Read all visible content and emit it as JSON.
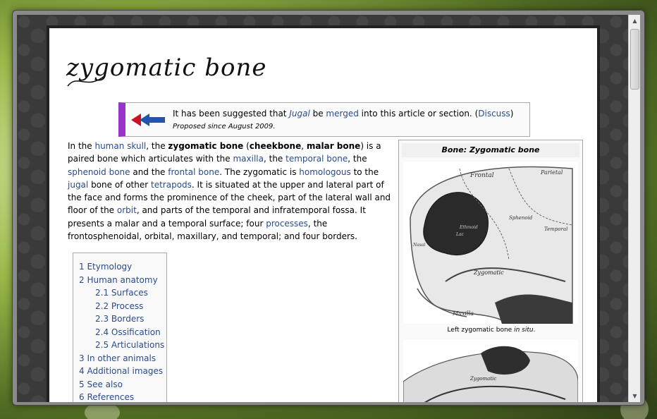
{
  "page": {
    "logo_text": "zygomatic bone"
  },
  "notice": {
    "prefix": "It has been suggested that ",
    "link_jugal": "Jugal",
    "middle1": " be ",
    "link_merged": "merged",
    "middle2": " into this article or section. (",
    "link_discuss": "Discuss",
    "suffix": ")",
    "subtext": "Proposed since August 2009.",
    "accent_color": "#9933cc",
    "icon": "merge-arrows-icon"
  },
  "intro": {
    "t1": "In the ",
    "l_human_skull": "human skull",
    "t2": ", the ",
    "b_zygomatic": "zygomatic bone",
    "t3": " (",
    "b_cheekbone": "cheekbone",
    "t4": ", ",
    "b_malar": "malar bone",
    "t5": ") is a paired bone which articulates with the ",
    "l_maxilla": "maxilla",
    "t6": ", the ",
    "l_temporal": "temporal bone",
    "t7": ", the ",
    "l_sphenoid": "sphenoid bone",
    "t8": " and the ",
    "l_frontal": "frontal bone",
    "t9": ". The zygomatic is ",
    "l_homologous": "homologous",
    "t10": " to the ",
    "l_jugal": "jugal",
    "t11": " bone of other ",
    "l_tetrapods": "tetrapods",
    "t12": ". It is situated at the upper and lateral part of the face and forms the prominence of the cheek, part of the lateral wall and floor of the ",
    "l_orbit": "orbit",
    "t13": ", and parts of the temporal and infratemporal fossa. It presents a malar and a temporal surface; four ",
    "l_processes": "processes",
    "t14": ", the frontosphenoidal, orbital, maxillary, and temporal; and four borders."
  },
  "toc": {
    "items": [
      {
        "label": "1 Etymology",
        "sub": false
      },
      {
        "label": "2 Human anatomy",
        "sub": false
      },
      {
        "label": "2.1 Surfaces",
        "sub": true
      },
      {
        "label": "2.2 Process",
        "sub": true
      },
      {
        "label": "2.3 Borders",
        "sub": true
      },
      {
        "label": "2.4 Ossification",
        "sub": true
      },
      {
        "label": "2.5 Articulations",
        "sub": true
      },
      {
        "label": "3 In other animals",
        "sub": false
      },
      {
        "label": "4 Additional images",
        "sub": false
      },
      {
        "label": "5 See also",
        "sub": false
      },
      {
        "label": "6 References",
        "sub": false
      }
    ]
  },
  "infobox": {
    "title": "Bone: Zygomatic bone",
    "caption_pre": "Left zygomatic bone ",
    "caption_em": "in situ",
    "caption_post": ".",
    "image_labels": {
      "frontal": "Frontal",
      "parietal": "Parietal",
      "sphenoid": "Sphenoid",
      "temporal": "Temporal",
      "zygomatic": "Zygomatic",
      "maxilla": "Maxilla",
      "nasal": "Nasal",
      "lac": "Lac",
      "ethmoid": "Ethmoid",
      "zygomatic2": "Zygomatic"
    }
  },
  "scrollbar": {
    "up": "▲",
    "down": "▼"
  }
}
